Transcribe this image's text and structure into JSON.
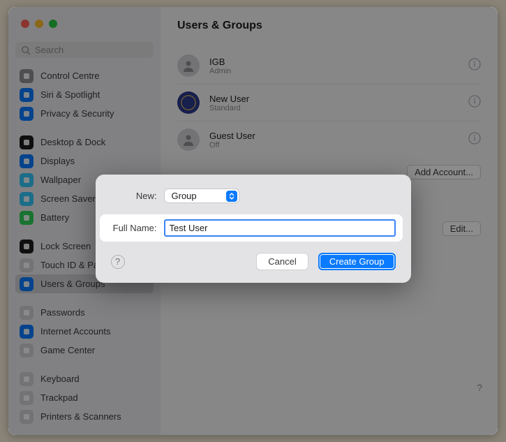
{
  "page_title": "Users & Groups",
  "search_placeholder": "Search",
  "sidebar_groups": [
    {
      "items": [
        {
          "label": "Control Centre",
          "color": "#8e8e93",
          "icon": "toggles"
        },
        {
          "label": "Siri & Spotlight",
          "color": "#0a7aff",
          "icon": "siri"
        },
        {
          "label": "Privacy & Security",
          "color": "#0a7aff",
          "icon": "hand"
        }
      ]
    },
    {
      "items": [
        {
          "label": "Desktop & Dock",
          "color": "#1c1c1e",
          "icon": "dock"
        },
        {
          "label": "Displays",
          "color": "#0a7aff",
          "icon": "display"
        },
        {
          "label": "Wallpaper",
          "color": "#34c7f9",
          "icon": "wallpaper"
        },
        {
          "label": "Screen Saver",
          "color": "#34c7f9",
          "icon": "screensaver"
        },
        {
          "label": "Battery",
          "color": "#30d158",
          "icon": "battery"
        }
      ]
    },
    {
      "items": [
        {
          "label": "Lock Screen",
          "color": "#1c1c1e",
          "icon": "lock"
        },
        {
          "label": "Touch ID & Password",
          "color": "#d1d1d6",
          "icon": "touchid"
        },
        {
          "label": "Users & Groups",
          "color": "#0a7aff",
          "icon": "users",
          "selected": true
        }
      ]
    },
    {
      "items": [
        {
          "label": "Passwords",
          "color": "#d1d1d6",
          "icon": "key"
        },
        {
          "label": "Internet Accounts",
          "color": "#0a7aff",
          "icon": "at"
        },
        {
          "label": "Game Center",
          "color": "#d1d1d6",
          "icon": "game"
        }
      ]
    },
    {
      "items": [
        {
          "label": "Keyboard",
          "color": "#d1d1d6",
          "icon": "keyboard"
        },
        {
          "label": "Trackpad",
          "color": "#d1d1d6",
          "icon": "trackpad"
        },
        {
          "label": "Printers & Scanners",
          "color": "#d1d1d6",
          "icon": "printer"
        }
      ]
    }
  ],
  "users": [
    {
      "name": "IGB",
      "role": "Admin",
      "avatar": "person"
    },
    {
      "name": "New User",
      "role": "Standard",
      "avatar": "circle"
    },
    {
      "name": "Guest User",
      "role": "Off",
      "avatar": "guest"
    }
  ],
  "add_account_label": "Add Account...",
  "edit_label": "Edit...",
  "modal": {
    "new_label": "New:",
    "type_value": "Group",
    "fullname_label": "Full Name:",
    "fullname_value": "Test User",
    "cancel_label": "Cancel",
    "create_label": "Create Group"
  }
}
